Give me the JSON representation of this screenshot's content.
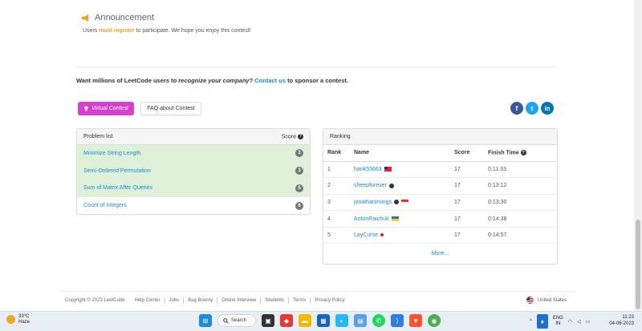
{
  "announcement": {
    "title": "Announcement",
    "text_before": "Users ",
    "text_strong": "must register",
    "text_after": " to participate. We hope you enjoy this contest!"
  },
  "sponsor": {
    "text1": "Want millions of LeetCode users to ",
    "emph": "recognize your company",
    "text2": "? ",
    "link": "Contact us",
    "text3": " to sponsor a contest."
  },
  "buttons": {
    "virtual": "Virtual Contest",
    "faq": "FAQ about Contest"
  },
  "social": {
    "facebook": "f",
    "twitter": "t",
    "linkedin": "in"
  },
  "problems": {
    "header_left": "Problem list",
    "header_right": "Score",
    "items": [
      {
        "name": "Minimize String Length",
        "score": "3",
        "solved": true
      },
      {
        "name": "Semi-Ordered Permutation",
        "score": "3",
        "solved": true
      },
      {
        "name": "Sum of Matrix After Queries",
        "score": "5",
        "solved": true
      },
      {
        "name": "Count of Integers",
        "score": "6",
        "solved": false
      }
    ]
  },
  "ranking": {
    "title": "Ranking",
    "columns": [
      "Rank",
      "Name",
      "Score",
      "Finish Time"
    ],
    "rows": [
      {
        "rank": "1",
        "name": "hank55663",
        "score": "17",
        "time": "0:11:33",
        "flag": "tw"
      },
      {
        "rank": "2",
        "name": "sheepforever",
        "score": "17",
        "time": "0:13:12",
        "flag": "pirate"
      },
      {
        "rank": "3",
        "name": "jonathanirvings",
        "score": "17",
        "time": "0:13:30",
        "flag": "sg"
      },
      {
        "rank": "4",
        "name": "AntonRaichuk",
        "score": "17",
        "time": "0:14:38",
        "flag": "ua"
      },
      {
        "rank": "5",
        "name": "LayCurse",
        "score": "17",
        "time": "0:14:57",
        "flag": "jp"
      }
    ],
    "more": "More..."
  },
  "footer": {
    "copyright": "Copyright © 2023 LeetCode",
    "links": [
      "Help Center",
      "Jobs",
      "Bug Bounty",
      "Online Interview",
      "Students",
      "Terms",
      "Privacy Policy"
    ],
    "locale": "United States"
  },
  "taskbar": {
    "temp": "33°C",
    "weather": "Haze",
    "search": "Search",
    "lang1": "ENG",
    "lang2": "IN",
    "time": "11:23",
    "date": "04-06-2023"
  },
  "colors": {
    "accent": "#1a8ad8",
    "virtual": "#d63fcf",
    "solved": "#dff0d8",
    "register": "#f0a02c"
  }
}
